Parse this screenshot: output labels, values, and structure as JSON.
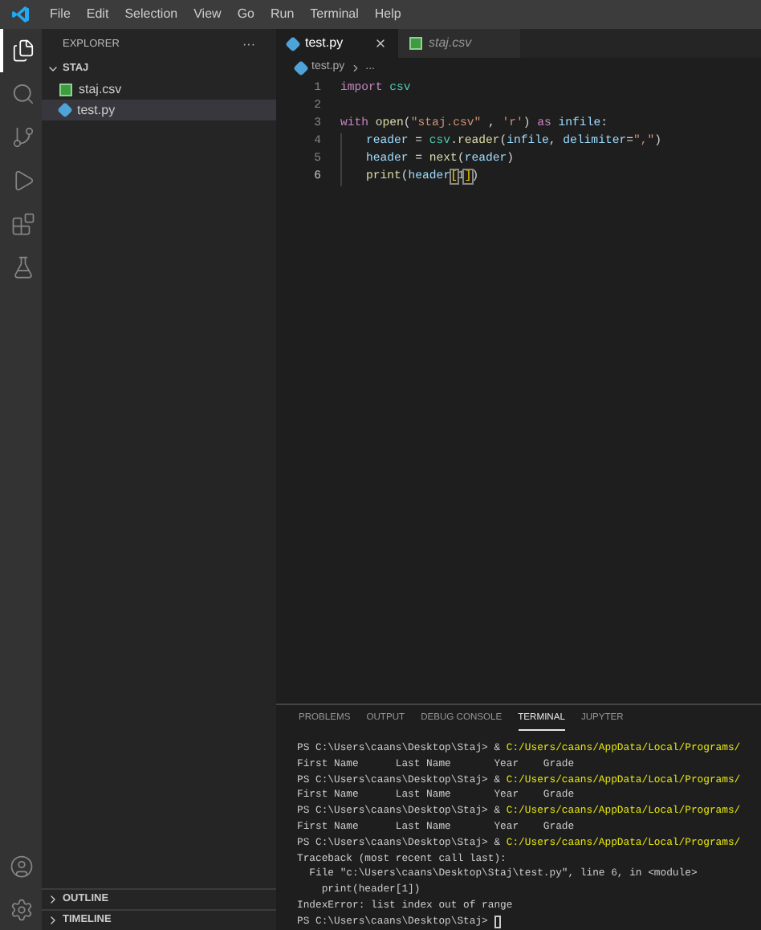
{
  "menu": [
    "File",
    "Edit",
    "Selection",
    "View",
    "Go",
    "Run",
    "Terminal",
    "Help"
  ],
  "activity_bar": [
    {
      "kind": "files",
      "selected": true
    },
    {
      "kind": "search",
      "selected": false
    },
    {
      "kind": "source-control",
      "selected": false
    },
    {
      "kind": "run",
      "selected": false
    },
    {
      "kind": "extensions",
      "selected": false
    },
    {
      "kind": "testing",
      "selected": false
    }
  ],
  "sidebar": {
    "title": "EXPLORER",
    "more": "···",
    "folder": {
      "name": "STAJ",
      "expanded": true,
      "files": [
        {
          "name": "staj.csv",
          "kind": "csv",
          "selected": false
        },
        {
          "name": "test.py",
          "kind": "python",
          "selected": true
        }
      ]
    },
    "sections": [
      {
        "name": "OUTLINE",
        "expanded": false
      },
      {
        "name": "TIMELINE",
        "expanded": false
      }
    ]
  },
  "tabs": [
    {
      "label": "test.py",
      "kind": "python",
      "selected": true,
      "preview": false
    },
    {
      "label": "staj.csv",
      "kind": "csv",
      "selected": false,
      "preview": true
    }
  ],
  "breadcrumb": {
    "file": "test.py",
    "rest": "..."
  },
  "code": [
    {
      "number": "1",
      "active": false,
      "indented": false,
      "tokens": [
        {
          "kind": "keyword",
          "text": "import"
        },
        {
          "kind": "module",
          "text": " csv"
        }
      ]
    },
    {
      "number": "2",
      "active": false,
      "indented": false
    },
    {
      "number": "3",
      "active": false,
      "indented": false,
      "tokens": [
        {
          "kind": "keyword",
          "text": "with"
        },
        {
          "kind": "function",
          "text": " open"
        },
        {
          "kind": "plain",
          "text": "("
        },
        {
          "kind": "string",
          "text": "\"staj.csv\""
        },
        {
          "kind": "plain",
          "text": " , "
        },
        {
          "kind": "string",
          "text": "'r'"
        },
        {
          "kind": "plain",
          "text": ") "
        },
        {
          "kind": "keyword",
          "text": "as"
        },
        {
          "kind": "variable",
          "text": " infile"
        },
        {
          "kind": "plain",
          "text": ":"
        }
      ]
    },
    {
      "number": "4",
      "active": false,
      "indented": true,
      "tokens": [
        {
          "kind": "variable",
          "text": "reader"
        },
        {
          "kind": "plain",
          "text": " = "
        },
        {
          "kind": "module",
          "text": "csv"
        },
        {
          "kind": "plain",
          "text": "."
        },
        {
          "kind": "function",
          "text": "reader"
        },
        {
          "kind": "plain",
          "text": "("
        },
        {
          "kind": "variable",
          "text": "infile"
        },
        {
          "kind": "plain",
          "text": ", "
        },
        {
          "kind": "variable",
          "text": "delimiter"
        },
        {
          "kind": "plain",
          "text": "="
        },
        {
          "kind": "string",
          "text": "\",\""
        },
        {
          "kind": "plain",
          "text": ")"
        }
      ]
    },
    {
      "number": "5",
      "active": false,
      "indented": true,
      "tokens": [
        {
          "kind": "variable",
          "text": "header"
        },
        {
          "kind": "plain",
          "text": " = "
        },
        {
          "kind": "function",
          "text": "next"
        },
        {
          "kind": "plain",
          "text": "("
        },
        {
          "kind": "variable",
          "text": "reader"
        },
        {
          "kind": "plain",
          "text": ")"
        }
      ]
    },
    {
      "number": "6",
      "active": true,
      "indented": true,
      "tokens": [
        {
          "kind": "function",
          "text": "print"
        },
        {
          "kind": "plain",
          "text": "("
        },
        {
          "kind": "variable",
          "text": "header"
        },
        {
          "kind": "bracket",
          "text": "["
        },
        {
          "kind": "number",
          "text": "1"
        },
        {
          "kind": "bracket",
          "text": "]"
        },
        {
          "kind": "plain",
          "text": ")"
        }
      ]
    }
  ],
  "panel": {
    "tabs": [
      {
        "label": "PROBLEMS",
        "selected": false
      },
      {
        "label": "OUTPUT",
        "selected": false
      },
      {
        "label": "DEBUG CONSOLE",
        "selected": false
      },
      {
        "label": "TERMINAL",
        "selected": true
      },
      {
        "label": "JUPYTER",
        "selected": false
      }
    ],
    "terminal": [
      [
        {
          "kind": "plain",
          "text": "PS C:\\Users\\caans\\Desktop\\Staj> & "
        },
        {
          "kind": "path",
          "text": "C:/Users/caans/AppData/Local/Programs/"
        }
      ],
      [
        {
          "kind": "plain",
          "text": "First Name      Last Name       Year    Grade"
        }
      ],
      [
        {
          "kind": "plain",
          "text": "PS C:\\Users\\caans\\Desktop\\Staj> & "
        },
        {
          "kind": "path",
          "text": "C:/Users/caans/AppData/Local/Programs/"
        }
      ],
      [
        {
          "kind": "plain",
          "text": "First Name      Last Name       Year    Grade"
        }
      ],
      [
        {
          "kind": "plain",
          "text": "PS C:\\Users\\caans\\Desktop\\Staj> & "
        },
        {
          "kind": "path",
          "text": "C:/Users/caans/AppData/Local/Programs/"
        }
      ],
      [
        {
          "kind": "plain",
          "text": "First Name      Last Name       Year    Grade"
        }
      ],
      [
        {
          "kind": "plain",
          "text": "PS C:\\Users\\caans\\Desktop\\Staj> & "
        },
        {
          "kind": "path",
          "text": "C:/Users/caans/AppData/Local/Programs/"
        }
      ],
      [
        {
          "kind": "plain",
          "text": "Traceback (most recent call last):"
        }
      ],
      [
        {
          "kind": "plain",
          "text": "  File \"c:\\Users\\caans\\Desktop\\Staj\\test.py\", line 6, in <module>"
        }
      ],
      [
        {
          "kind": "plain",
          "text": "    print(header[1])"
        }
      ],
      [
        {
          "kind": "plain",
          "text": "IndexError: list index out of range"
        }
      ],
      [
        {
          "kind": "plain",
          "text": "PS C:\\Users\\caans\\Desktop\\Staj> "
        },
        {
          "kind": "cursor"
        }
      ]
    ]
  }
}
